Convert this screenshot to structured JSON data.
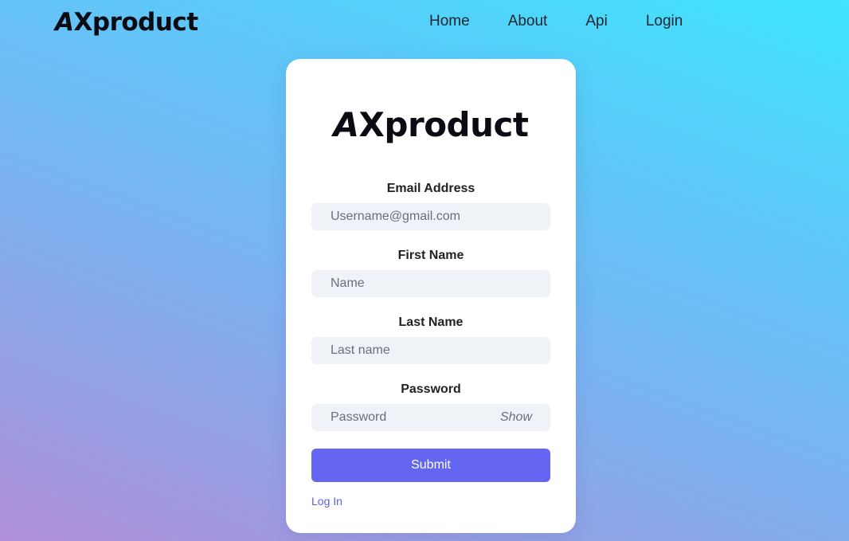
{
  "nav": {
    "brand_a": "A",
    "brand_rest": "Xproduct",
    "links": [
      {
        "label": "Home"
      },
      {
        "label": "About"
      },
      {
        "label": "Api"
      },
      {
        "label": "Login"
      }
    ]
  },
  "card": {
    "logo_a": "A",
    "logo_rest": "Xproduct",
    "fields": [
      {
        "label": "Email Address",
        "placeholder": "Username@gmail.com",
        "value": ""
      },
      {
        "label": "First Name",
        "placeholder": "Name",
        "value": ""
      },
      {
        "label": "Last Name",
        "placeholder": "Last name",
        "value": ""
      },
      {
        "label": "Password",
        "placeholder": "Password",
        "value": ""
      }
    ],
    "show_label": "Show",
    "submit_label": "Submit",
    "login_link": "Log In"
  },
  "colors": {
    "accent": "#6466f1",
    "link": "#5b5fe0",
    "input_bg": "#eff2f7"
  }
}
